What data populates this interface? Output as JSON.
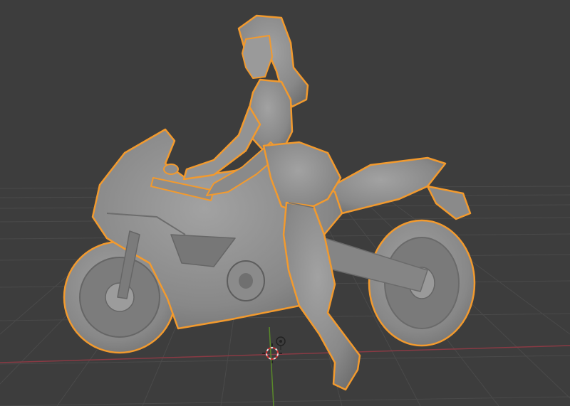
{
  "app": {
    "name": "3D Viewport"
  },
  "viewport": {
    "background": "#3d3d3d",
    "grid_color": "#4a4a4a",
    "x_axis_color": "#8a3a44",
    "y_axis_color": "#5a8a2a",
    "selection_outline_color": "#f29a2e",
    "model_color": "#8e8e8e"
  },
  "scene": {
    "selected_object": "rider-and-motorcycle",
    "icons": [
      "3d-cursor-icon",
      "light-icon"
    ]
  }
}
